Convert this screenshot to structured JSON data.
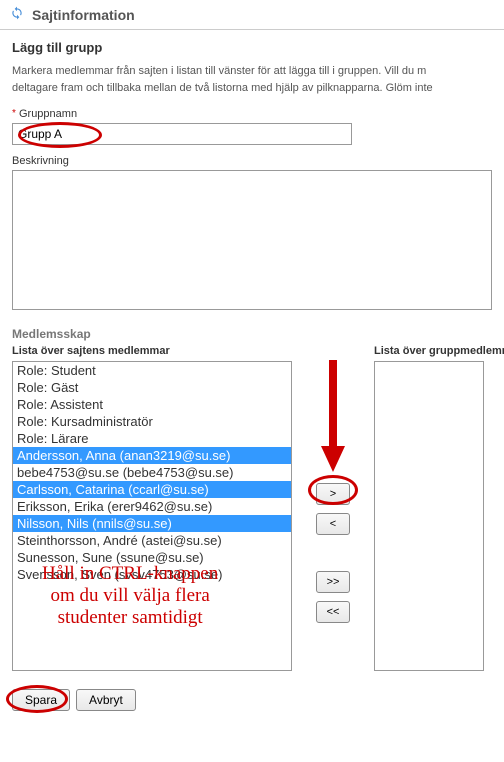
{
  "header": {
    "title": "Sajtinformation"
  },
  "section_title": "Lägg till grupp",
  "instructions": "Markera medlemmar från sajten i listan till vänster för att lägga till i gruppen. Vill du m\ndeltagare fram och tillbaka mellan de två listorna med hjälp av pilknapparna. Glöm inte",
  "group_name": {
    "label": "Gruppnamn",
    "value": "Grupp A"
  },
  "description": {
    "label": "Beskrivning",
    "value": ""
  },
  "membership_title": "Medlemsskap",
  "site_list_label": "Lista över sajtens medlemmar",
  "group_list_label": "Lista över gruppmedlemmar",
  "site_members": [
    {
      "text": "Role: Student",
      "selected": false
    },
    {
      "text": "Role: Gäst",
      "selected": false
    },
    {
      "text": "Role: Assistent",
      "selected": false
    },
    {
      "text": "Role: Kursadministratör",
      "selected": false
    },
    {
      "text": "Role: Lärare",
      "selected": false
    },
    {
      "text": "Andersson, Anna (anan3219@su.se)",
      "selected": true
    },
    {
      "text": "bebe4753@su.se (bebe4753@su.se)",
      "selected": false
    },
    {
      "text": "Carlsson, Catarina (ccarl@su.se)",
      "selected": true
    },
    {
      "text": "Eriksson, Erika (erer9462@su.se)",
      "selected": false
    },
    {
      "text": "Nilsson, Nils (nnils@su.se)",
      "selected": true
    },
    {
      "text": "Steinthorsson, André (astei@su.se)",
      "selected": false
    },
    {
      "text": "Sunesson, Sune (ssune@su.se)",
      "selected": false
    },
    {
      "text": "Svensson, Sven (svsv4753@su.se)",
      "selected": false
    }
  ],
  "buttons": {
    "add": ">",
    "remove": "<",
    "add_all": ">>",
    "remove_all": "<<"
  },
  "actions": {
    "save": "Spara",
    "cancel": "Avbryt"
  },
  "annotation": "Håll in CTRL-knappen\nom du vill välja flera\nstudenter samtidigt"
}
